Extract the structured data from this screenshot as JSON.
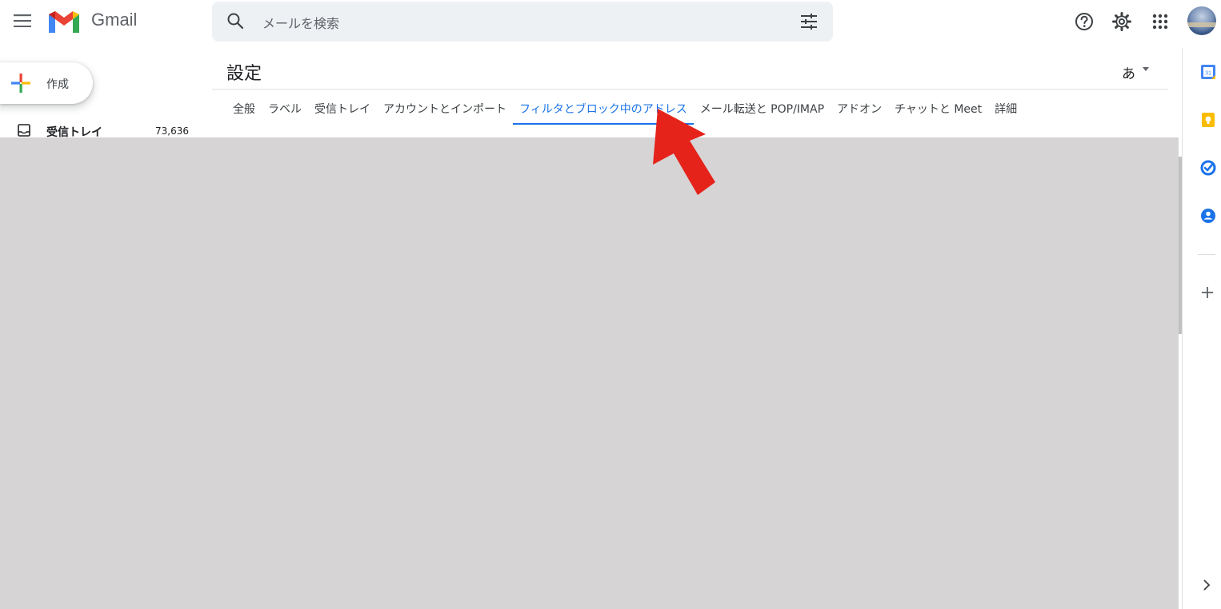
{
  "app": {
    "name": "Gmail"
  },
  "header": {
    "search_placeholder": "メールを検索"
  },
  "compose": {
    "label": "作成"
  },
  "nav": {
    "inbox": {
      "label": "受信トレイ",
      "count": "73,636"
    }
  },
  "settings": {
    "title": "設定",
    "ime_indicator": "あ",
    "tabs": [
      {
        "label": "全般",
        "active": false
      },
      {
        "label": "ラベル",
        "active": false
      },
      {
        "label": "受信トレイ",
        "active": false
      },
      {
        "label": "アカウントとインポート",
        "active": false
      },
      {
        "label": "フィルタとブロック中のアドレス",
        "active": true
      },
      {
        "label": "メール転送と POP/IMAP",
        "active": false
      },
      {
        "label": "アドオン",
        "active": false
      },
      {
        "label": "チャットと Meet",
        "active": false
      },
      {
        "label": "詳細",
        "active": false
      }
    ]
  },
  "icons": {
    "menu": "hamburger-menu-icon",
    "search": "search-icon",
    "search_options": "tune-icon",
    "help": "help-icon",
    "settings": "gear-icon",
    "apps": "apps-grid-icon",
    "calendar": "calendar-icon",
    "keep": "keep-icon",
    "tasks": "tasks-icon",
    "contacts": "contacts-icon",
    "add": "plus-icon",
    "expand": "chevron-right-icon"
  },
  "colors": {
    "accent": "#1a73e8",
    "overlay": "#d6d4d5",
    "annotation_arrow": "#e5231b",
    "gmail_red": "#ea4335",
    "gmail_blue": "#4285f4",
    "gmail_green": "#34a853",
    "gmail_yellow": "#fbbc04"
  }
}
